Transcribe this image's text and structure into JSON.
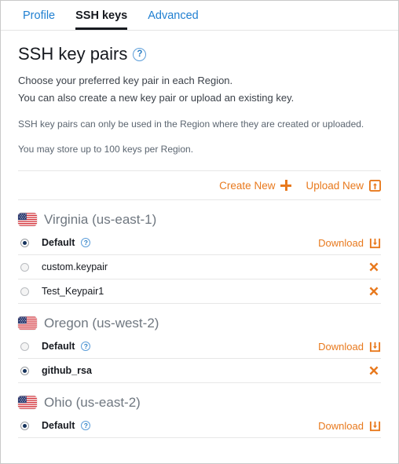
{
  "tabs": [
    {
      "label": "Profile",
      "active": false
    },
    {
      "label": "SSH keys",
      "active": true
    },
    {
      "label": "Advanced",
      "active": false
    }
  ],
  "header": {
    "title": "SSH key pairs",
    "help_icon": "question-circle-icon",
    "lead_line_1": "Choose your preferred key pair in each Region.",
    "lead_line_2": "You can also create a new key pair or upload an existing key.",
    "note_1": "SSH key pairs can only be used in the Region where they are created or uploaded.",
    "note_2": "You may store up to 100 keys per Region."
  },
  "actions": {
    "create_label": "Create New",
    "create_icon": "plus-icon",
    "upload_label": "Upload New",
    "upload_icon": "upload-box-icon"
  },
  "labels": {
    "download": "Download",
    "download_icon": "download-box-icon",
    "delete_icon": "close-x-icon",
    "flag_icon": "us-flag-icon"
  },
  "colors": {
    "accent_orange": "#e8791d",
    "link_blue": "#1f7fd1",
    "text_dark": "#16191f",
    "region_gray": "#6f7780",
    "divider": "#e7e7e7",
    "radio_dot": "#16335c"
  },
  "regions": [
    {
      "name": "Virginia (us-east-1)",
      "keys": [
        {
          "name": "Default",
          "selected": true,
          "bold": true,
          "has_help": true,
          "action": "download"
        },
        {
          "name": "custom.keypair",
          "selected": false,
          "bold": false,
          "has_help": false,
          "action": "delete"
        },
        {
          "name": "Test_Keypair1",
          "selected": false,
          "bold": false,
          "has_help": false,
          "action": "delete"
        }
      ]
    },
    {
      "name": "Oregon (us-west-2)",
      "keys": [
        {
          "name": "Default",
          "selected": false,
          "bold": true,
          "has_help": true,
          "action": "download"
        },
        {
          "name": "github_rsa",
          "selected": true,
          "bold": true,
          "has_help": false,
          "action": "delete"
        }
      ]
    },
    {
      "name": "Ohio (us-east-2)",
      "keys": [
        {
          "name": "Default",
          "selected": true,
          "bold": true,
          "has_help": true,
          "action": "download"
        }
      ]
    }
  ]
}
